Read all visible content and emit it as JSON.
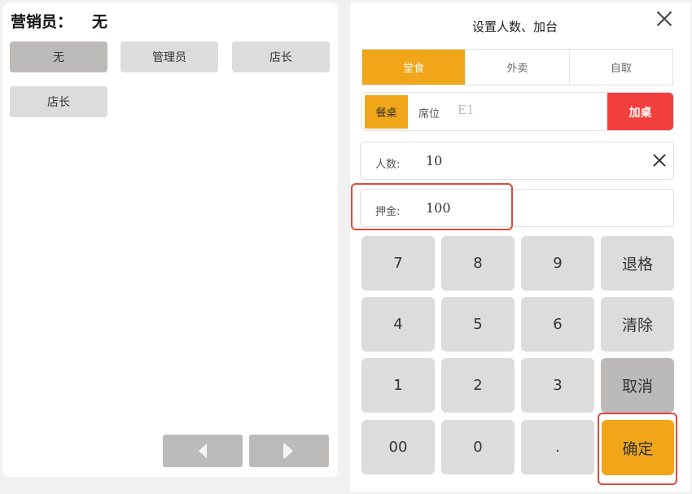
{
  "left": {
    "salesman_label": "营销员：",
    "salesman_value": "无",
    "staff_buttons": [
      {
        "label": "无"
      },
      {
        "label": "管理员"
      },
      {
        "label": "店长"
      },
      {
        "label": "店长"
      }
    ]
  },
  "dialog": {
    "title": "设置人数、加台",
    "tabs": [
      {
        "label": "堂食",
        "active": true
      },
      {
        "label": "外卖",
        "active": false
      },
      {
        "label": "自取",
        "active": false
      }
    ],
    "table": {
      "tag": "餐桌",
      "seat_label": "席位",
      "seat_value": "E1",
      "add_button": "加桌"
    },
    "people": {
      "label": "人数:",
      "value": "10"
    },
    "deposit": {
      "label": "押金:",
      "value": "100"
    },
    "keypad": {
      "k7": "7",
      "k8": "8",
      "k9": "9",
      "backspace": "退格",
      "k4": "4",
      "k5": "5",
      "k6": "6",
      "clear": "清除",
      "k1": "1",
      "k2": "2",
      "k3": "3",
      "cancel": "取消",
      "k00": "00",
      "k0": "0",
      "dot": ".",
      "confirm": "确定"
    }
  },
  "colors": {
    "accent": "#f0a618",
    "danger": "#f23f3c",
    "annotation": "#e2483b"
  }
}
